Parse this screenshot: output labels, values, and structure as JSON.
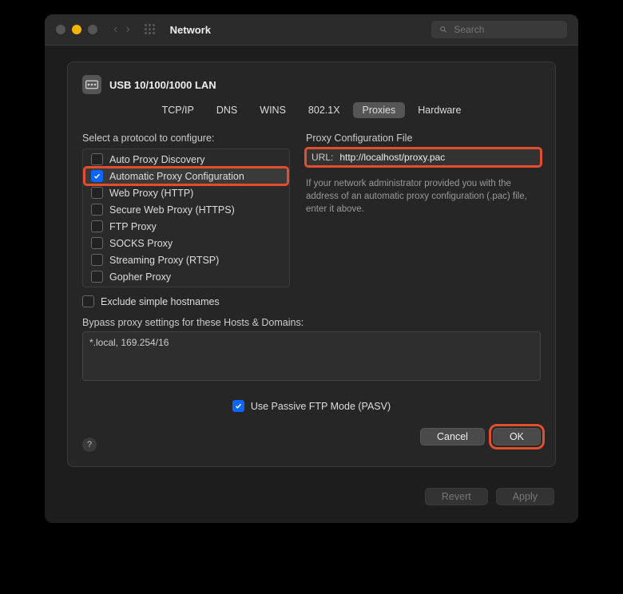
{
  "window": {
    "title": "Network",
    "search_placeholder": "Search",
    "traffic_colors": [
      "#555",
      "#f5b301",
      "#555"
    ]
  },
  "interface": {
    "name": "USB 10/100/1000 LAN"
  },
  "tabs": [
    "TCP/IP",
    "DNS",
    "WINS",
    "802.1X",
    "Proxies",
    "Hardware"
  ],
  "active_tab": "Proxies",
  "left": {
    "label": "Select a protocol to configure:",
    "protocols": [
      {
        "label": "Auto Proxy Discovery",
        "checked": false,
        "selected": false
      },
      {
        "label": "Automatic Proxy Configuration",
        "checked": true,
        "selected": true,
        "highlight": true
      },
      {
        "label": "Web Proxy (HTTP)",
        "checked": false,
        "selected": false
      },
      {
        "label": "Secure Web Proxy (HTTPS)",
        "checked": false,
        "selected": false
      },
      {
        "label": "FTP Proxy",
        "checked": false,
        "selected": false
      },
      {
        "label": "SOCKS Proxy",
        "checked": false,
        "selected": false
      },
      {
        "label": "Streaming Proxy (RTSP)",
        "checked": false,
        "selected": false
      },
      {
        "label": "Gopher Proxy",
        "checked": false,
        "selected": false
      }
    ],
    "exclude_label": "Exclude simple hostnames",
    "exclude_checked": false
  },
  "right": {
    "title": "Proxy Configuration File",
    "url_label": "URL:",
    "url_value": "http://localhost/proxy.pac",
    "hint": "If your network administrator provided you with the address of an automatic proxy configuration (.pac) file, enter it above."
  },
  "bypass": {
    "label": "Bypass proxy settings for these Hosts & Domains:",
    "value": "*.local, 169.254/16"
  },
  "passive": {
    "label": "Use Passive FTP Mode (PASV)",
    "checked": true
  },
  "buttons": {
    "cancel": "Cancel",
    "ok": "OK",
    "revert": "Revert",
    "apply": "Apply",
    "help": "?"
  }
}
